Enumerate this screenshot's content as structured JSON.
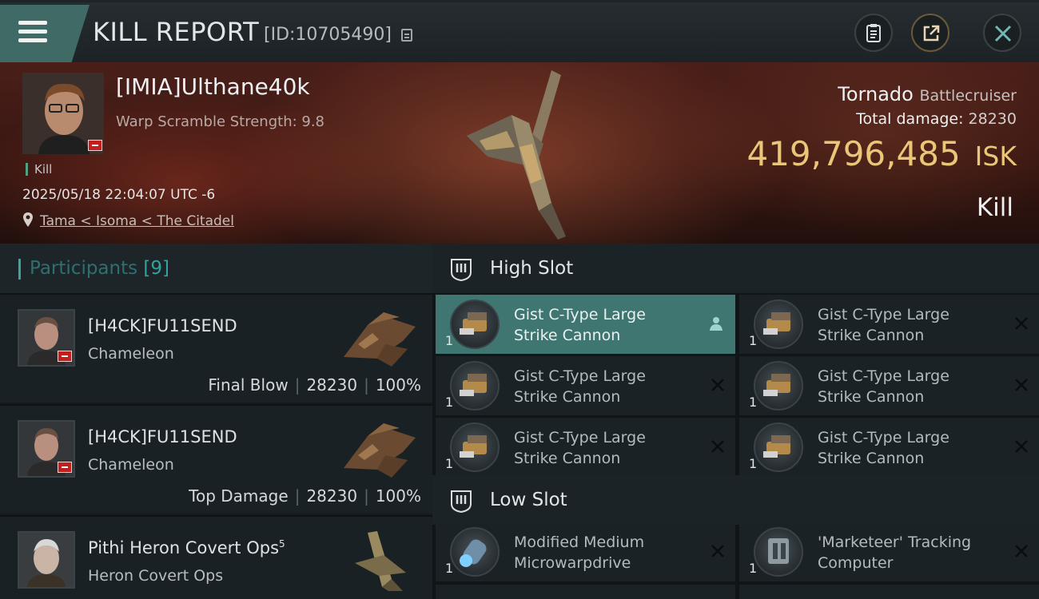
{
  "header": {
    "title": "KILL REPORT",
    "id_text": "[ID:10705490]"
  },
  "victim": {
    "name": "[IMIA]Ulthane40k",
    "warp_scramble": "Warp Scramble Strength: 9.8",
    "kill_tag": "Kill",
    "timestamp": "2025/05/18 22:04:07 UTC -6",
    "location": "Tama < Isoma < The Citadel",
    "ship_name": "Tornado",
    "ship_class": "Battlecruiser",
    "total_damage_label": "Total damage:",
    "total_damage": "28230",
    "isk_value": "419,796,485",
    "isk_unit": "ISK",
    "result": "Kill"
  },
  "participants": {
    "title": "Participants",
    "count": "[9]",
    "rows": [
      {
        "name": "[H4CK]FU11SEND",
        "ship": "Chameleon",
        "role": "Final Blow",
        "damage": "28230",
        "percent": "100%"
      },
      {
        "name": "[H4CK]FU11SEND",
        "ship": "Chameleon",
        "role": "Top Damage",
        "damage": "28230",
        "percent": "100%"
      },
      {
        "name": "Pithi Heron Covert Ops",
        "name_sup": "5",
        "ship": "Heron Covert Ops"
      }
    ]
  },
  "fittings": {
    "high_slot_title": "High Slot",
    "low_slot_title": "Low Slot",
    "high_slot": [
      {
        "qty": "1",
        "line1": "Gist C-Type Large",
        "line2": "Strike Cannon",
        "status": "dropped-self"
      },
      {
        "qty": "1",
        "line1": "Gist C-Type Large",
        "line2": "Strike Cannon",
        "status": "destroyed"
      },
      {
        "qty": "1",
        "line1": "Gist C-Type Large",
        "line2": "Strike Cannon",
        "status": "destroyed"
      },
      {
        "qty": "1",
        "line1": "Gist C-Type Large",
        "line2": "Strike Cannon",
        "status": "destroyed"
      },
      {
        "qty": "1",
        "line1": "Gist C-Type Large",
        "line2": "Strike Cannon",
        "status": "destroyed"
      },
      {
        "qty": "1",
        "line1": "Gist C-Type Large",
        "line2": "Strike Cannon",
        "status": "destroyed"
      }
    ],
    "low_slot": [
      {
        "qty": "1",
        "line1": "Modified Medium",
        "line2": "Microwarpdrive",
        "status": "destroyed"
      },
      {
        "qty": "1",
        "line1": "'Marketeer' Tracking",
        "line2": "Computer",
        "status": "destroyed"
      }
    ]
  },
  "icons": {
    "menu": "hamburger-menu-icon",
    "copy": "copy-icon",
    "clipboard": "clipboard-icon",
    "share": "share-external-icon",
    "close": "close-x-icon",
    "location": "map-pin-icon",
    "slot": "shield-slot-icon",
    "destroyed": "x-icon",
    "owner": "person-icon"
  },
  "colors": {
    "accent_teal": "#3f7671",
    "isk_gold": "#e9c678",
    "kill_green": "#4fa37f",
    "minus_red": "#c21f1f"
  }
}
